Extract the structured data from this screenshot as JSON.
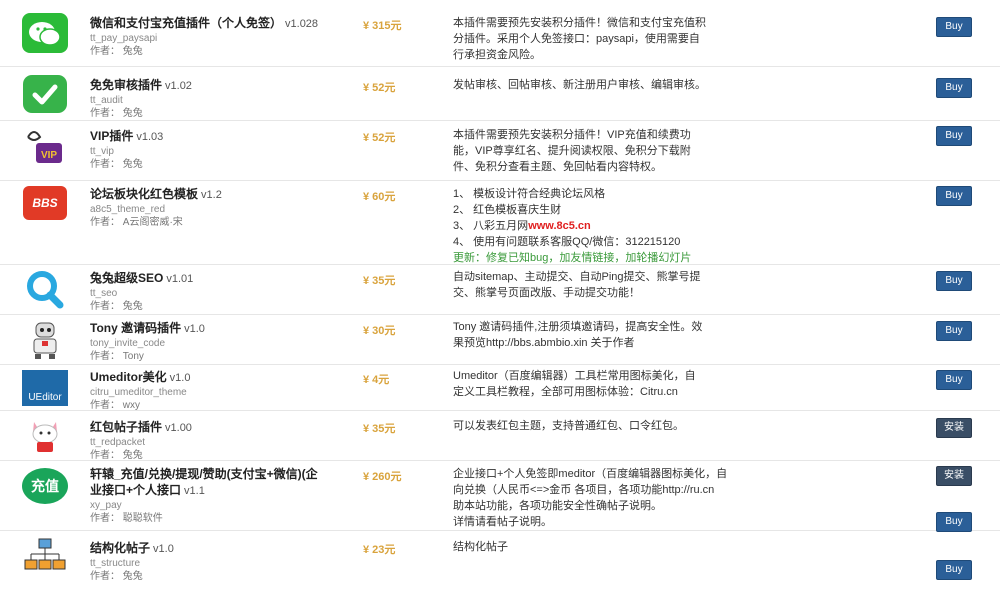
{
  "plugins": [
    {
      "name": "微信和支付宝充值插件（个人免签）",
      "version": "v1.028",
      "slug": "tt_pay_paysapi",
      "author": "作者： 兔兔",
      "price": "¥ 315元",
      "desc": [
        "本插件需要预先安装积分插件！微信和支付宝充值积",
        "分插件。采用个人免签接口：paysapi，使用需要自",
        "行承担资金风险。"
      ],
      "button": "Buy",
      "icon": "wechat-icon"
    },
    {
      "name": "免免审核插件",
      "version": "v1.02",
      "slug": "tt_audit",
      "author": "作者： 兔兔",
      "price": "¥ 52元",
      "desc": [
        "发帖审核、回帖审核、新注册用户审核、编辑审核。"
      ],
      "button": "Buy",
      "icon": "checkmark-icon"
    },
    {
      "name": "VIP插件",
      "version": "v1.03",
      "slug": "tt_vip",
      "author": "作者： 兔兔",
      "price": "¥ 52元",
      "desc": [
        "本插件需要预先安装积分插件！VIP充值和续费功",
        "能，VIP尊享红名、提升阅读权限、免积分下载附",
        "件、免积分查看主题、免回帖看内容特权。"
      ],
      "button": "Buy",
      "icon": "vip-icon"
    },
    {
      "name": "论坛板块化红色模板",
      "version": "v1.2",
      "slug": "a8c5_theme_red",
      "author": "作者： A云阁密威·宋",
      "price": "¥ 60元",
      "desc": [
        "1、 模板设计符合经典论坛风格",
        "2、 红色模板喜庆生财",
        "3、 八彩五月网",
        "4、 使用有问题联系客服QQ/微信：312215120",
        "更新：修复已知bug，加友情链接，加轮播幻灯片"
      ],
      "desc_link": "www.8c5.cn",
      "button": "Buy",
      "icon": "bbs-icon",
      "icon_text": "BBS"
    },
    {
      "name": "兔兔超级SEO",
      "version": "v1.01",
      "slug": "tt_seo",
      "author": "作者： 兔兔",
      "price": "¥ 35元",
      "desc": [
        "自动sitemap、主动提交、自动Ping提交、熊掌号提",
        "交、熊掌号页面改版、手动提交功能！"
      ],
      "button": "Buy",
      "icon": "magnifier-icon"
    },
    {
      "name": "Tony 邀请码插件",
      "version": "v1.0",
      "slug": "tony_invite_code",
      "author": "作者： Tony",
      "price": "¥ 30元",
      "desc": [
        "Tony 邀请码插件,注册须填邀请码，提高安全性。效",
        "果预览http://bbs.abmbio.xin 关于作者"
      ],
      "button": "Buy",
      "icon": "robot-icon"
    },
    {
      "name": "Umeditor美化",
      "version": "v1.0",
      "slug": "citru_umeditor_theme",
      "author": "作者： wxy",
      "price": "¥ 4元",
      "desc": [
        "Umeditor（百度编辑器）工具栏常用图标美化，自",
        "定义工具栏教程，全部可用图标体验：Citru.cn"
      ],
      "button": "Buy",
      "icon": "ueditor-icon",
      "icon_text": "UEditor"
    },
    {
      "name": "红包帖子插件",
      "version": "v1.00",
      "slug": "tt_redpacket",
      "author": "作者： 兔兔",
      "price": "¥ 35元",
      "desc": [
        "可以发表红包主题，支持普通红包、口令红包。"
      ],
      "button": "安装",
      "icon": "cat-icon"
    },
    {
      "name": "轩辕_充值/兑换/提现/赞助(支付宝+微信)(企",
      "name2": "业接口+个人接口",
      "version": "v1.1",
      "slug": "xy_pay",
      "author": "作者： 聪聪软件",
      "price": "¥ 260元",
      "desc": [
        "企业接口+个人免签即meditor（百度编辑器图标美化，自",
        "向兑换（人民币<=>金币   各项目，各项功能http://ru.cn",
        "助本站功能，各项功能安全性确帖子说明。",
        "详情请看帖子说明。"
      ],
      "button": "安装",
      "button2": "Buy",
      "icon": "charge-icon",
      "icon_text": "充值"
    },
    {
      "name": "结构化帖子",
      "version": "v1.0",
      "slug": "tt_structure",
      "author": "作者： 兔兔",
      "price": "¥ 23元",
      "desc": [
        "结构化帖子"
      ],
      "button": "Buy",
      "icon": "hierarchy-icon"
    }
  ]
}
